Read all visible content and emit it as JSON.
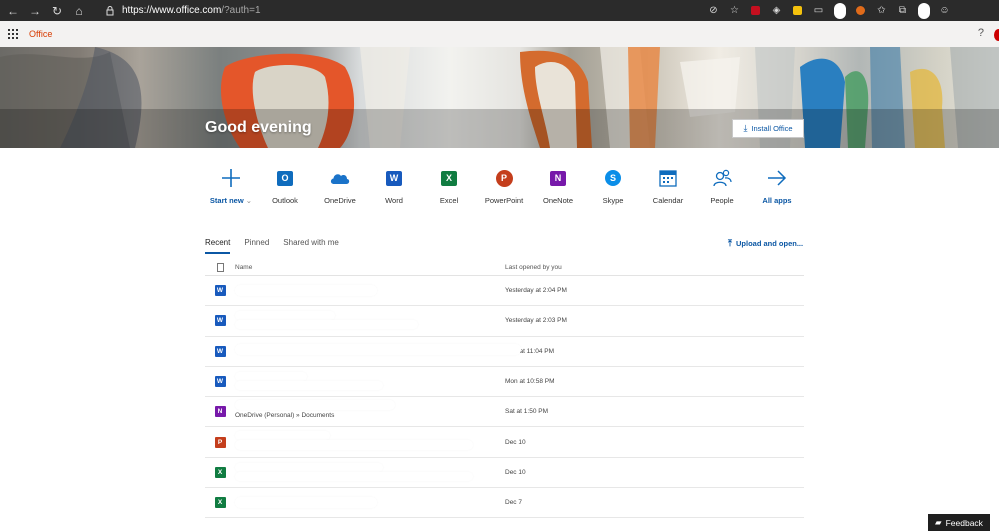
{
  "browser": {
    "url_main": "https://www.office.com",
    "url_query": "/?auth=1",
    "nav_icons": [
      "back-icon",
      "forward-icon",
      "refresh-icon",
      "home-icon"
    ]
  },
  "header": {
    "brand": "Office",
    "help": "?"
  },
  "hero": {
    "greeting": "Good evening",
    "install_label": "Install Office"
  },
  "apps": [
    {
      "label": "Start new",
      "icon": "plus-icon",
      "extra": "⌄"
    },
    {
      "label": "Outlook",
      "icon": "outlook-icon",
      "letter": "O",
      "color": "#0f6cbd"
    },
    {
      "label": "OneDrive",
      "icon": "onedrive-icon",
      "color": "#0f6cbd"
    },
    {
      "label": "Word",
      "icon": "word-icon",
      "letter": "W",
      "color": "#185abd"
    },
    {
      "label": "Excel",
      "icon": "excel-icon",
      "letter": "X",
      "color": "#107c41"
    },
    {
      "label": "PowerPoint",
      "icon": "powerpoint-icon",
      "letter": "P",
      "color": "#c43e1c"
    },
    {
      "label": "OneNote",
      "icon": "onenote-icon",
      "letter": "N",
      "color": "#7719aa"
    },
    {
      "label": "Skype",
      "icon": "skype-icon",
      "letter": "S",
      "color": "#0078d4"
    },
    {
      "label": "Calendar",
      "icon": "calendar-icon",
      "color": "#0f6cbd"
    },
    {
      "label": "People",
      "icon": "people-icon",
      "color": "#0f6cbd"
    },
    {
      "label": "All apps",
      "icon": "arrow-right-icon",
      "color": "#0f6cbd"
    }
  ],
  "tabs": [
    "Recent",
    "Pinned",
    "Shared with me"
  ],
  "upload_label": "Upload and open...",
  "table": {
    "col_name": "Name",
    "col_opened": "Last opened by you",
    "rows": [
      {
        "type": "word",
        "letter": "W",
        "location": "",
        "opened": "Yesterday at 2:04 PM"
      },
      {
        "type": "word",
        "letter": "W",
        "location": "",
        "opened": "Yesterday at 2:03 PM"
      },
      {
        "type": "word",
        "letter": "W",
        "location": "",
        "opened": "Mon at 11:04 PM"
      },
      {
        "type": "word",
        "letter": "W",
        "location": "",
        "opened": "Mon at 10:58 PM"
      },
      {
        "type": "onenote",
        "letter": "N",
        "location": "OneDrive (Personal) » Documents",
        "opened": "Sat at 1:50 PM"
      },
      {
        "type": "ppt",
        "letter": "P",
        "location": "",
        "opened": "Dec 10"
      },
      {
        "type": "excel",
        "letter": "X",
        "location": "",
        "opened": "Dec 10"
      },
      {
        "type": "excel",
        "letter": "X",
        "location": "",
        "opened": "Dec 7"
      }
    ]
  },
  "feedback_label": "Feedback"
}
